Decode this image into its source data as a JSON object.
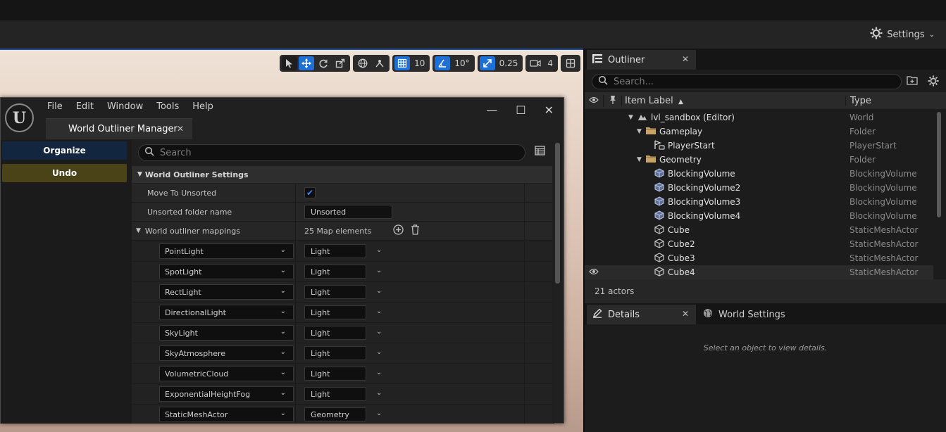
{
  "toolbar": {
    "settings_label": "Settings"
  },
  "viewport": {
    "grid_snap_value": "10",
    "rotation_snap_value": "10°",
    "scale_snap_value": "0.25",
    "camera_speed_value": "4"
  },
  "wom": {
    "menu": [
      "File",
      "Edit",
      "Window",
      "Tools",
      "Help"
    ],
    "tab_title": "World Outliner Manager",
    "organize_label": "Organize",
    "undo_label": "Undo",
    "search_placeholder": "Search",
    "settings_section": "World Outliner Settings",
    "move_to_unsorted_label": "Move To Unsorted",
    "move_to_unsorted_checked": true,
    "unsorted_folder_label": "Unsorted folder name",
    "unsorted_folder_value": "Unsorted",
    "mappings_label": "World outliner mappings",
    "mappings_count": "25 Map elements",
    "mappings": [
      {
        "key": "PointLight",
        "value": "Light"
      },
      {
        "key": "SpotLight",
        "value": "Light"
      },
      {
        "key": "RectLight",
        "value": "Light"
      },
      {
        "key": "DirectionalLight",
        "value": "Light"
      },
      {
        "key": "SkyLight",
        "value": "Light"
      },
      {
        "key": "SkyAtmosphere",
        "value": "Light"
      },
      {
        "key": "VolumetricCloud",
        "value": "Light"
      },
      {
        "key": "ExponentialHeightFog",
        "value": "Light"
      },
      {
        "key": "StaticMeshActor",
        "value": "Geometry"
      }
    ]
  },
  "outliner": {
    "tab_label": "Outliner",
    "search_placeholder": "Search...",
    "col_label": "Item Label",
    "col_type": "Type",
    "rows": [
      {
        "name": "lvl_sandbox (Editor)",
        "type": "World"
      },
      {
        "name": "Gameplay",
        "type": "Folder"
      },
      {
        "name": "PlayerStart",
        "type": "PlayerStart"
      },
      {
        "name": "Geometry",
        "type": "Folder"
      },
      {
        "name": "BlockingVolume",
        "type": "BlockingVolume"
      },
      {
        "name": "BlockingVolume2",
        "type": "BlockingVolume"
      },
      {
        "name": "BlockingVolume3",
        "type": "BlockingVolume"
      },
      {
        "name": "BlockingVolume4",
        "type": "BlockingVolume"
      },
      {
        "name": "Cube",
        "type": "StaticMeshActor"
      },
      {
        "name": "Cube2",
        "type": "StaticMeshActor"
      },
      {
        "name": "Cube3",
        "type": "StaticMeshActor"
      },
      {
        "name": "Cube4",
        "type": "StaticMeshActor"
      }
    ],
    "actor_count": "21 actors"
  },
  "details": {
    "tab_label": "Details",
    "world_settings_label": "World Settings",
    "empty_text": "Select an object to view details."
  }
}
